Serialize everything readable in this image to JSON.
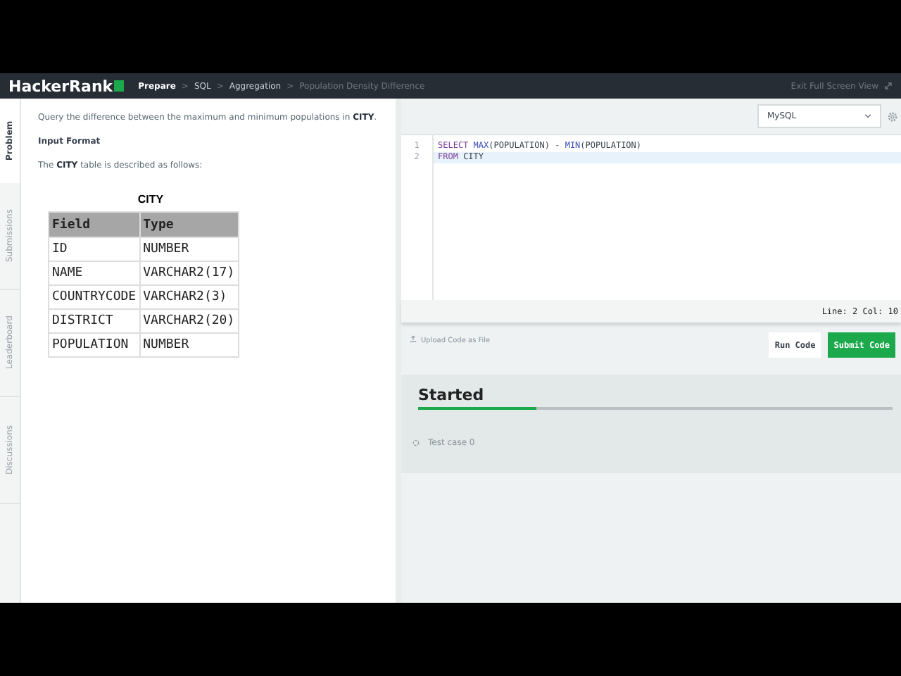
{
  "header": {
    "logo": "HackerRank",
    "breadcrumbs": [
      {
        "label": "Prepare",
        "current": false,
        "strong": true
      },
      {
        "label": "SQL",
        "current": false,
        "strong": false
      },
      {
        "label": "Aggregation",
        "current": false,
        "strong": false
      },
      {
        "label": "Population Density Difference",
        "current": true,
        "strong": false
      }
    ],
    "separator": ">",
    "exit_label": "Exit Full Screen View"
  },
  "side_tabs": [
    {
      "label": "Problem",
      "selected": true
    },
    {
      "label": "Submissions",
      "selected": false
    },
    {
      "label": "Leaderboard",
      "selected": false
    },
    {
      "label": "Discussions",
      "selected": false
    }
  ],
  "problem": {
    "statement": "Query the difference between the maximum and minimum populations in **CITY**.",
    "input_heading": "Input Format",
    "table_intro": "The **CITY** table is described as follows:",
    "table_title": "CITY",
    "table": {
      "columns": [
        "Field",
        "Type"
      ],
      "rows": [
        [
          "ID",
          "NUMBER"
        ],
        [
          "NAME",
          "VARCHAR2(17)"
        ],
        [
          "COUNTRYCODE",
          "VARCHAR2(3)"
        ],
        [
          "DISTRICT",
          "VARCHAR2(20)"
        ],
        [
          "POPULATION",
          "NUMBER"
        ]
      ]
    }
  },
  "editor": {
    "language": "MySQL",
    "lines": [
      {
        "number": "1",
        "selected": false,
        "tokens": [
          {
            "text": "SELECT ",
            "kind": "keyword"
          },
          {
            "text": "MAX",
            "kind": "function"
          },
          {
            "text": "(POPULATION) - ",
            "kind": "plain"
          },
          {
            "text": "MIN",
            "kind": "function"
          },
          {
            "text": "(POPULATION)",
            "kind": "plain"
          }
        ]
      },
      {
        "number": "2",
        "selected": true,
        "tokens": [
          {
            "text": "FROM",
            "kind": "keyword"
          },
          {
            "text": " CITY",
            "kind": "plain"
          }
        ]
      }
    ],
    "status": "Line: 2 Col: 10"
  },
  "actions": {
    "upload_label": "Upload Code as File",
    "buttons": [
      {
        "label": "Run Code",
        "kind": "secondary"
      },
      {
        "label": "Submit Code",
        "kind": "primary"
      }
    ]
  },
  "results": {
    "title": "Started",
    "level": 0.25,
    "test_cases": [
      {
        "label": "Test case 0"
      }
    ]
  }
}
